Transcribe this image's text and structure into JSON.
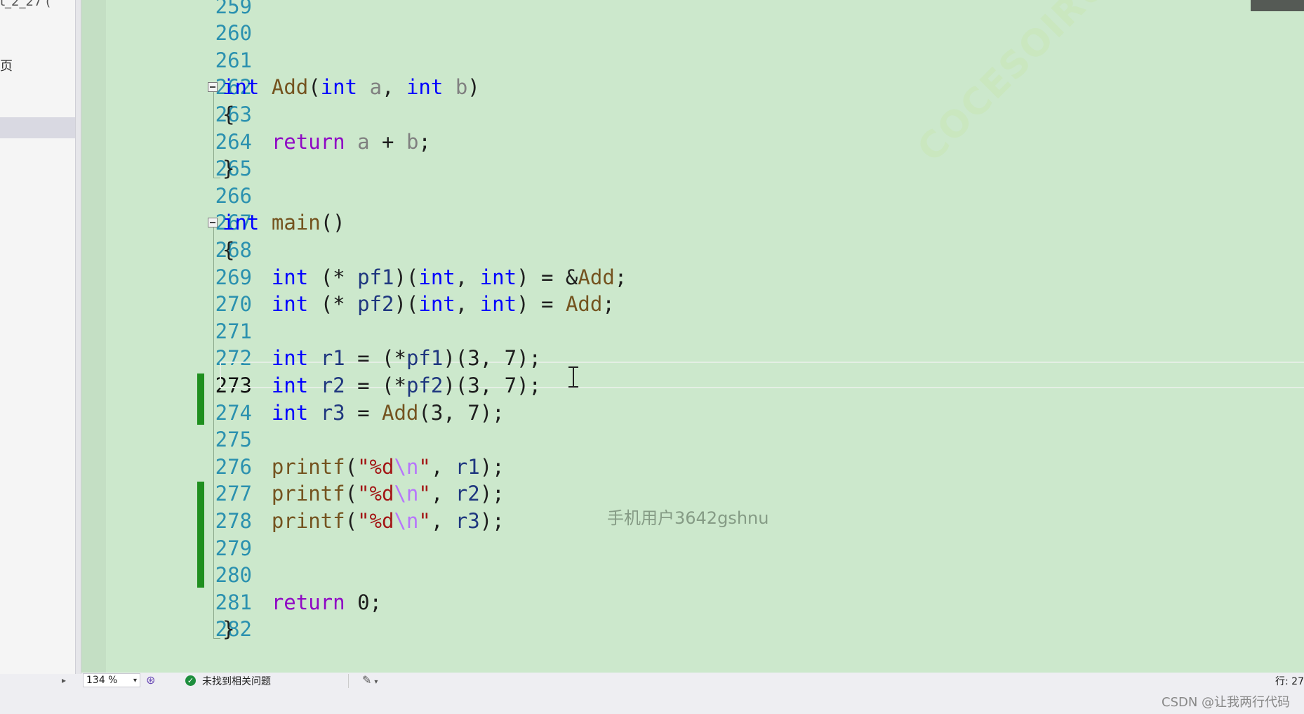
{
  "sidebar": {
    "top_text": "t_2_27  (",
    "page_text": "页",
    "expand_icon": "▸"
  },
  "editor": {
    "current_line": 273,
    "lines": [
      {
        "n": "259",
        "code": ""
      },
      {
        "n": "260",
        "code": ""
      },
      {
        "n": "261",
        "code": ""
      },
      {
        "n": "262",
        "code": "int Add(int a, int b)"
      },
      {
        "n": "263",
        "code": "{"
      },
      {
        "n": "264",
        "code": "    return a + b;"
      },
      {
        "n": "265",
        "code": "}"
      },
      {
        "n": "266",
        "code": ""
      },
      {
        "n": "267",
        "code": "int main()"
      },
      {
        "n": "268",
        "code": "{"
      },
      {
        "n": "269",
        "code": "    int (* pf1)(int, int) = &Add;"
      },
      {
        "n": "270",
        "code": "    int (* pf2)(int, int) = Add;"
      },
      {
        "n": "271",
        "code": ""
      },
      {
        "n": "272",
        "code": "    int r1 = (*pf1)(3, 7);"
      },
      {
        "n": "273",
        "code": "    int r2 = (*pf2)(3, 7);"
      },
      {
        "n": "274",
        "code": "    int r3 = Add(3, 7);"
      },
      {
        "n": "275",
        "code": ""
      },
      {
        "n": "276",
        "code": "    printf(\"%d\\n\", r1);"
      },
      {
        "n": "277",
        "code": "    printf(\"%d\\n\", r2);"
      },
      {
        "n": "278",
        "code": "    printf(\"%d\\n\", r3);"
      },
      {
        "n": "279",
        "code": ""
      },
      {
        "n": "280",
        "code": ""
      },
      {
        "n": "281",
        "code": "    return 0;"
      },
      {
        "n": "282",
        "code": "}"
      }
    ],
    "changed_lines": [
      "273",
      "274",
      "277",
      "278",
      "279",
      "280"
    ],
    "watermark_user": "手机用户3642gshnu",
    "watermark_diag": "COCESOIRU"
  },
  "status": {
    "zoom": "134 %",
    "issues": "未找到相关问题",
    "row_label": "行: 27",
    "icons": {
      "zoom_dropdown": "chevron-down-icon",
      "ai": "copilot-icon",
      "ok": "check-circle-icon",
      "brush": "code-cleanup-icon"
    }
  },
  "credit": "CSDN @让我两行代码",
  "colors": {
    "editor_bg": "#cce8cc",
    "line_number": "#2b91af",
    "keyword": "#0000ff",
    "control_keyword": "#8f08c4",
    "function": "#74531f",
    "parameter": "#808080",
    "local_variable": "#1f377f",
    "string": "#a31515",
    "escape": "#b776fb",
    "change_bar": "#1f8f1f"
  }
}
